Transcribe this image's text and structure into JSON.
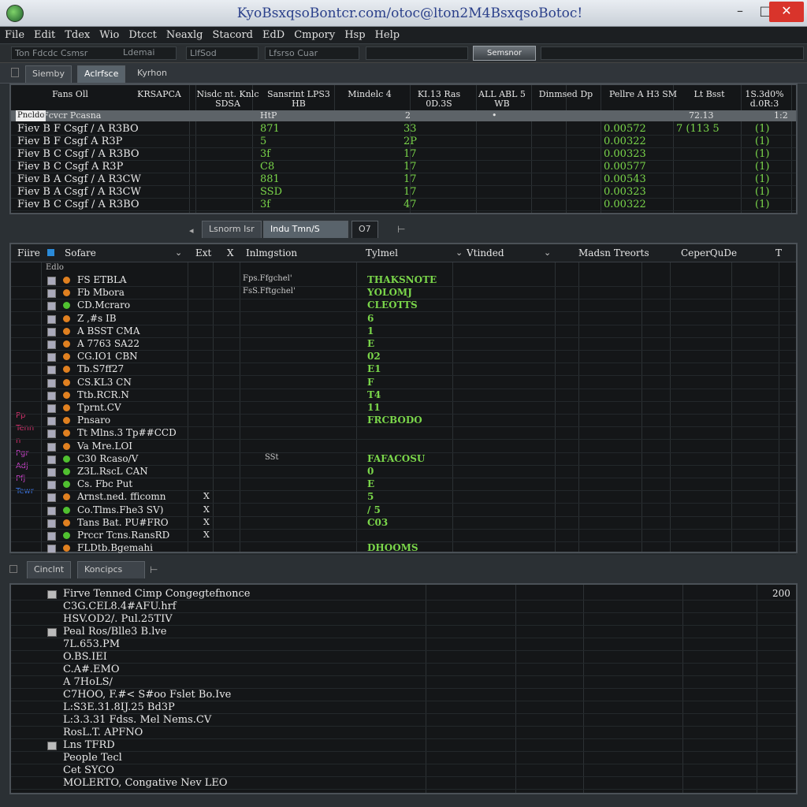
{
  "window": {
    "title": "KyoBsxqsoBontcr.com/otoc@lton2M4BsxqsoBotoc!",
    "close_label": "✕",
    "max_label": "□",
    "min_label": "–"
  },
  "menu": [
    "File",
    "Edit",
    "Tdex",
    "Wio",
    "Dtcct",
    "Neaxlg",
    "Stacord",
    "EdD",
    "Cmpory",
    "Hsp",
    "Help"
  ],
  "toolbar": {
    "field1": "Ton Fdcdc Csmsr",
    "field2": "Ldemai",
    "field3": "LlfSod",
    "field4": "Lfsrso Cuar",
    "button": "Semsnor"
  },
  "top_tabs": [
    "Siemby",
    "Aclrfsce",
    "Kyrhon"
  ],
  "top_table": {
    "headers": [
      "Fans Oll",
      "KRSAPCA",
      "Nisdc nt. Knlc SDSA",
      "Sansrint LPS3 HB",
      "Mindelc 4",
      "KI.13 Ras 0D.3S",
      "ALL ABL 5 WB",
      "Dinmsed Dp",
      "Pellre A H3 SM",
      "Lt Bsst",
      "1S.3d0% d.0R:3"
    ],
    "selected_row": [
      "Pncldo",
      "Fcvcr Pcasna",
      "HtP",
      "2",
      "•",
      "72.13",
      "1:2"
    ],
    "rows": [
      {
        "name": "Fiev B F Csgf / A R3BO",
        "c1": "871",
        "c2": "33",
        "c3": "0.00572",
        "c4": "7 (113 5",
        "c5": "(1)"
      },
      {
        "name": "Fiev B F Csgf A R3P",
        "c1": "5",
        "c2": "2P",
        "c3": "0.00322",
        "c4": "",
        "c5": "(1)"
      },
      {
        "name": "Fiev B C Csgf / A R3BO",
        "c1": "3f",
        "c2": "17",
        "c3": "0.00323",
        "c4": "",
        "c5": "(1)"
      },
      {
        "name": "Fiev B C Csgf A R3P",
        "c1": "C8",
        "c2": "17",
        "c3": "0.00577",
        "c4": "",
        "c5": "(1)"
      },
      {
        "name": "Fiev B A Csgf / A R3CW",
        "c1": "881",
        "c2": "17",
        "c3": "0.00543",
        "c4": "",
        "c5": "(1)"
      },
      {
        "name": "Fiev B A Csgf / A R3CW",
        "c1": "SSD",
        "c2": "17",
        "c3": "0.00323",
        "c4": "",
        "c5": "(1)"
      },
      {
        "name": "Fiev B C Csgf / A R3BO",
        "c1": "3f",
        "c2": "47",
        "c3": "0.00322",
        "c4": "",
        "c5": "(1)"
      }
    ]
  },
  "mid_tabs": [
    "Lsnorm Isr",
    "Indu Tmn/S",
    "O7"
  ],
  "mid_table": {
    "headers": [
      "Fiire",
      "Sofare",
      "Ext",
      "X",
      "Inlmgstion",
      "Tylmel",
      "Vtinded",
      "Madsn Treorts",
      "CeperQuDe",
      "T"
    ],
    "first_row": "Edlo",
    "side_tags": [
      {
        "text": "Pp",
        "color": "#d0306a"
      },
      {
        "text": "Tenn",
        "color": "#d0306a"
      },
      {
        "text": "n",
        "color": "#d0306a"
      },
      {
        "text": "Pgr",
        "color": "#c040c0"
      },
      {
        "text": "Adj",
        "color": "#c040c0"
      },
      {
        "text": "Pfj",
        "color": "#c040c0"
      },
      {
        "text": "Tewr",
        "color": "#3a70d8"
      }
    ],
    "rows": [
      {
        "name": "FS ETBLA",
        "dot": "#e08020",
        "x": "",
        "info": "Fps.Ffgchel'",
        "val": "THAKSNOTE"
      },
      {
        "name": "Fb Mbora",
        "dot": "#e08020",
        "x": "",
        "info": "FsS.Fftgchel'",
        "val": "YOLOMJ"
      },
      {
        "name": "CD.Mcraro",
        "dot": "#50c030",
        "x": "",
        "info": "",
        "val": "CLEOTTS"
      },
      {
        "name": "Z ,#s IB",
        "dot": "#e08020",
        "x": "",
        "info": "",
        "val": "6"
      },
      {
        "name": "A BSST CMA",
        "dot": "#e08020",
        "x": "",
        "info": "",
        "val": "1"
      },
      {
        "name": "A 7763 SA22",
        "dot": "#e08020",
        "x": "",
        "info": "",
        "val": "E"
      },
      {
        "name": "CG.IO1 CBN",
        "dot": "#e08020",
        "x": "",
        "info": "",
        "val": "02"
      },
      {
        "name": "Tb.S7ff27",
        "dot": "#e08020",
        "x": "",
        "info": "",
        "val": "E1"
      },
      {
        "name": "CS.KL3 CN",
        "dot": "#e08020",
        "x": "",
        "info": "",
        "val": "F"
      },
      {
        "name": "Ttb.RCR.N",
        "dot": "#e08020",
        "x": "",
        "info": "",
        "val": "T4"
      },
      {
        "name": "Tprnt.CV",
        "dot": "#e08020",
        "x": "",
        "info": "",
        "val": "11"
      },
      {
        "name": "Pnsaro",
        "dot": "#e08020",
        "x": "",
        "info": "",
        "val": "FRCBODO"
      },
      {
        "name": "Tt Mlns.3 Tp##CCD",
        "dot": "#e08020",
        "x": "",
        "info": "",
        "val": ""
      },
      {
        "name": "Va Mre.LOI",
        "dot": "#e08020",
        "x": "",
        "info": "",
        "val": ""
      },
      {
        "name": "C30 Rcaso/V",
        "dot": "#50c030",
        "x": "",
        "info": "SSt",
        "val": "FAFACOSU"
      },
      {
        "name": "Z3L.RscL CAN",
        "dot": "#50c030",
        "x": "",
        "info": "",
        "val": "0"
      },
      {
        "name": "Cs. Fbc Put",
        "dot": "#50c030",
        "x": "",
        "info": "",
        "val": "E"
      },
      {
        "name": "Arnst.ned. fficomn",
        "dot": "#e08020",
        "x": "X",
        "info": "",
        "val": "5"
      },
      {
        "name": "Co.Tlms.Fhe3 SV)",
        "dot": "#50c030",
        "x": "X",
        "info": "",
        "val": "/ 5"
      },
      {
        "name": "Tans Bat. PU#FRO",
        "dot": "#e08020",
        "x": "X",
        "info": "",
        "val": "C03"
      },
      {
        "name": "Prccr Tcns.RansRD",
        "dot": "#50c030",
        "x": "X",
        "info": "",
        "val": ""
      },
      {
        "name": "FLDtb.Bgemahi",
        "dot": "#e08020",
        "x": "",
        "info": "",
        "val": "DHOOMS"
      }
    ]
  },
  "bottom_tabs": [
    "Cinclnt",
    "Koncipcs"
  ],
  "bottom_list": {
    "count": "200",
    "items": [
      {
        "text": "Firve Tenned Cimp Congegtefnonce",
        "indent": 0,
        "icon": true
      },
      {
        "text": "C3G.CEL8.4#AFU.hrf",
        "indent": 1,
        "icon": false
      },
      {
        "text": "HSV.OD2/. Pul.25TIV",
        "indent": 1,
        "icon": false
      },
      {
        "text": "Peal Ros/Blle3 B.lve",
        "indent": 0,
        "icon": true
      },
      {
        "text": "7L.653.PM",
        "indent": 1,
        "icon": false
      },
      {
        "text": "O.BS.IEI",
        "indent": 1,
        "icon": false
      },
      {
        "text": "C.A#.EMO",
        "indent": 1,
        "icon": false
      },
      {
        "text": "A 7HoLS/",
        "indent": 1,
        "icon": false
      },
      {
        "text": "C7HOO, F.#< S#oo Fslet Bo.Ive",
        "indent": 1,
        "icon": false
      },
      {
        "text": "L:S3E.31.8IJ.25 Bd3P",
        "indent": 1,
        "icon": false
      },
      {
        "text": "L:3.3.31 Fdss. Mel Nems.CV",
        "indent": 1,
        "icon": false
      },
      {
        "text": "RosL.T. APFNO",
        "indent": 1,
        "icon": false
      },
      {
        "text": "Lns TFRD",
        "indent": 0,
        "icon": true
      },
      {
        "text": "People Tecl",
        "indent": 1,
        "icon": false
      },
      {
        "text": "Cet SYCO",
        "indent": 1,
        "icon": false
      },
      {
        "text": "MOLERTO, Congative Nev LEO",
        "indent": 1,
        "icon": false
      }
    ]
  }
}
